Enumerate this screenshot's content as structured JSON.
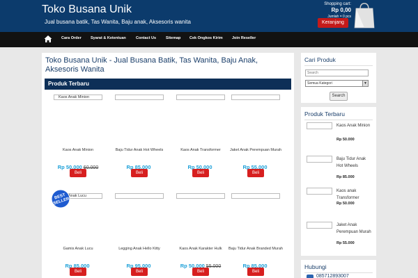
{
  "header": {
    "site_title": "Toko Busana Unik",
    "tagline": "Jual busana batik, Tas Wanita, Baju anak, Aksesoris wanita",
    "cart_label": "Shopping cart:",
    "cart_total": "Rp 0,00",
    "cart_count": "Jumlah = 0 pcs",
    "cart_button": "Keranjang",
    "bag_icon": "shopping-bag-icon"
  },
  "nav": {
    "home_icon": "home-icon",
    "items": [
      "Cara Order",
      "Syarat & Ketentuan",
      "Contact Us",
      "Sitemap",
      "Cek Ongkos Kirim",
      "Join Reseller"
    ]
  },
  "main": {
    "heading": "Toko Busana Unik - Jual Busana Batik, Tas Wanita, Baju Anak, Aksesoris Wanita",
    "section_title": "Produk Terbaru",
    "buy_label": "Beli",
    "best_seller_badge": "BEST SELLER",
    "products": [
      {
        "image_label": "Kaos Anak Minion",
        "name": "Kaos Anak Minion",
        "price": "Rp 50.000",
        "old_price": "60.000"
      },
      {
        "image_label": "",
        "name": "Baju Tidur Anak Hot Wheels",
        "price": "Rp 85.000",
        "old_price": ""
      },
      {
        "image_label": "",
        "name": "Kaos Anak Transformer",
        "price": "Rp 50.000",
        "old_price": ""
      },
      {
        "image_label": "",
        "name": "Jaket Anak Perempuan Murah",
        "price": "Rp 55.000",
        "old_price": ""
      },
      {
        "image_label": "Anak Lucu",
        "name": "Gamis Anak Lucu",
        "price": "Rp 85.000",
        "old_price": ""
      },
      {
        "image_label": "",
        "name": "Legging Anak Hello Kitty",
        "price": "Rp 95.000",
        "old_price": ""
      },
      {
        "image_label": "",
        "name": "Kaos Anak Karakter Hulk",
        "price": "Rp 50.000",
        "old_price": "55.000"
      },
      {
        "image_label": "",
        "name": "Baju Tidur Anak Branded Murah",
        "price": "Rp 85.000",
        "old_price": ""
      }
    ]
  },
  "sidebar": {
    "search": {
      "title": "Cari Produk",
      "placeholder": "Search",
      "category_selected": "Semua Kategori",
      "button": "Search"
    },
    "latest": {
      "title": "Produk Terbaru",
      "items": [
        {
          "name": "Kaos Anak Minion",
          "price": "Rp 50.000"
        },
        {
          "name": "Baju Tidur Anak Hot Wheels",
          "price": "Rp 85.000"
        },
        {
          "name": "Kaos anak Transformer",
          "price": "Rp 50.000"
        },
        {
          "name": "Jaket Anak Perempuan Murah",
          "price": "Rp 55.000"
        }
      ]
    },
    "contact": {
      "title": "Hubungi",
      "value": "085712893007"
    }
  }
}
